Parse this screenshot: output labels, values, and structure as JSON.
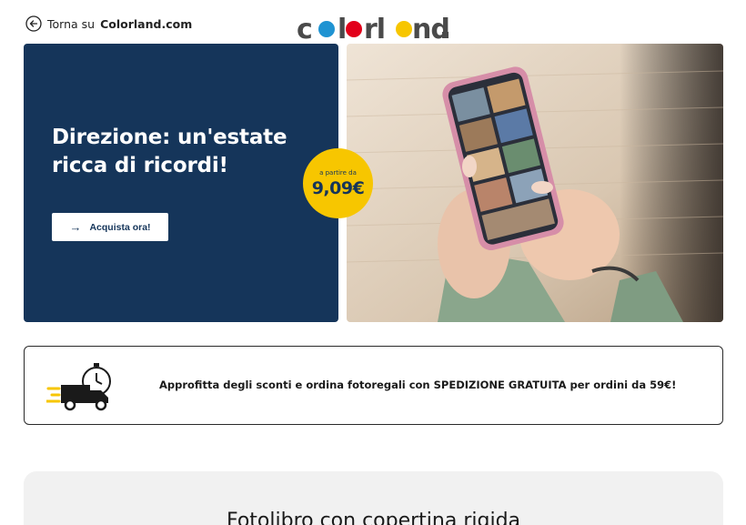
{
  "header": {
    "back_text": "Torna su",
    "back_brand": "Colorland.com",
    "logo_text": "colorland."
  },
  "hero": {
    "title": "Direzione: un'estate ricca di ricordi!",
    "cta_label": "Acquista ora!",
    "price_prefix": "a partire da",
    "price": "9,09€"
  },
  "promo": {
    "text": "Approfitta degli sconti e ordina fotoregali con SPEDIZIONE GRATUITA per ordini da 59€!"
  },
  "product": {
    "title": "Fotolibro con copertina rigida"
  },
  "colors": {
    "navy": "#15355a",
    "yellow": "#f7c600",
    "logo_gray": "#4a4a4a"
  }
}
